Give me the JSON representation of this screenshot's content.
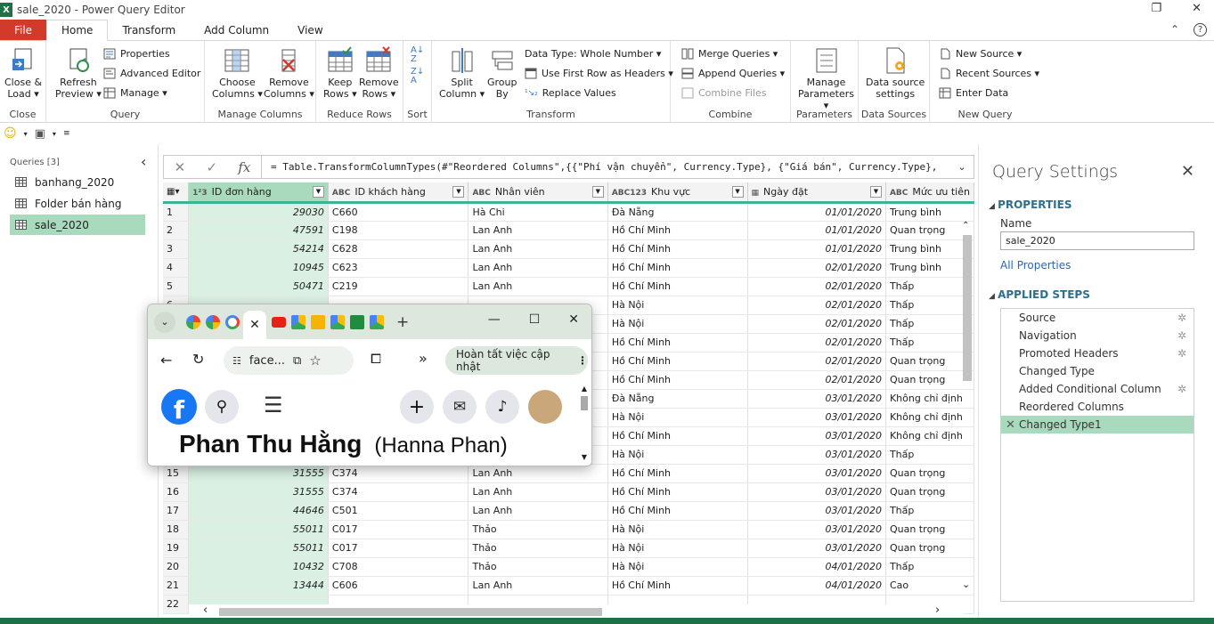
{
  "window": {
    "title": "sale_2020 - Power Query Editor",
    "app_icon": "X"
  },
  "tabs": [
    "File",
    "Home",
    "Transform",
    "Add Column",
    "View"
  ],
  "ribbon": {
    "close": {
      "close_load": "Close &",
      "close_load2": "Load",
      "label": "Close"
    },
    "query": {
      "refresh": "Refresh",
      "preview": "Preview",
      "properties": "Properties",
      "advanced_editor": "Advanced Editor",
      "manage": "Manage",
      "label": "Query"
    },
    "manage_columns": {
      "choose": "Choose",
      "choose2": "Columns",
      "remove": "Remove",
      "remove2": "Columns",
      "label": "Manage Columns"
    },
    "reduce_rows": {
      "keep": "Keep",
      "keep2": "Rows",
      "remove": "Remove",
      "remove2": "Rows",
      "label": "Reduce Rows"
    },
    "sort": {
      "label": "Sort"
    },
    "transform": {
      "split": "Split",
      "split2": "Column",
      "group": "Group",
      "group2": "By",
      "data_type": "Data Type: Whole Number",
      "first_row": "Use First Row as Headers",
      "replace": "Replace Values",
      "label": "Transform"
    },
    "combine": {
      "merge": "Merge Queries",
      "append": "Append Queries",
      "combine_files": "Combine Files",
      "label": "Combine"
    },
    "parameters": {
      "manage": "Manage",
      "manage2": "Parameters",
      "label": "Parameters"
    },
    "data_sources": {
      "settings": "Data source",
      "settings2": "settings",
      "label": "Data Sources"
    },
    "new_query": {
      "new_source": "New Source",
      "recent": "Recent Sources",
      "enter": "Enter Data",
      "label": "New Query"
    }
  },
  "queries": {
    "header": "Queries [3]",
    "items": [
      "banhang_2020",
      "Folder bán hàng",
      "sale_2020"
    ]
  },
  "formula": "= Table.TransformColumnTypes(#\"Reordered Columns\",{{\"Phí vận chuyển\", Currency.Type}, {\"Giá bán\", Currency.Type},",
  "columns": [
    {
      "type": "1²3",
      "name": "ID đơn hàng"
    },
    {
      "type": "ABC",
      "name": "ID khách hàng"
    },
    {
      "type": "ABC",
      "name": "Nhân viên"
    },
    {
      "type": "ABC123",
      "name": "Khu vực"
    },
    {
      "type": "▦",
      "name": "Ngày đặt"
    },
    {
      "type": "ABC",
      "name": "Mức ưu tiên"
    }
  ],
  "rows": [
    [
      "1",
      "29030",
      "C660",
      "Hà Chi",
      "Đà Nẵng",
      "01/01/2020",
      "Trung bình"
    ],
    [
      "2",
      "47591",
      "C198",
      "Lan Anh",
      "Hồ Chí Minh",
      "01/01/2020",
      "Quan trọng"
    ],
    [
      "3",
      "54214",
      "C628",
      "Lan Anh",
      "Hồ Chí Minh",
      "01/01/2020",
      "Trung bình"
    ],
    [
      "4",
      "10945",
      "C623",
      "Lan Anh",
      "Hồ Chí Minh",
      "02/01/2020",
      "Trung bình"
    ],
    [
      "5",
      "50471",
      "C219",
      "Lan Anh",
      "Hồ Chí Minh",
      "02/01/2020",
      "Thấp"
    ],
    [
      "6",
      "",
      "",
      "",
      "Hà Nội",
      "02/01/2020",
      "Thấp"
    ],
    [
      "7",
      "",
      "",
      "",
      "Hà Nội",
      "02/01/2020",
      "Thấp"
    ],
    [
      "8",
      "",
      "",
      "",
      "Hồ Chí Minh",
      "02/01/2020",
      "Thấp"
    ],
    [
      "9",
      "",
      "",
      "",
      "Hồ Chí Minh",
      "02/01/2020",
      "Quan trọng"
    ],
    [
      "10",
      "",
      "",
      "",
      "Hồ Chí Minh",
      "02/01/2020",
      "Quan trọng"
    ],
    [
      "11",
      "",
      "",
      "",
      "Đà Nẵng",
      "03/01/2020",
      "Không chỉ định"
    ],
    [
      "12",
      "",
      "",
      "",
      "Hà Nội",
      "03/01/2020",
      "Không chỉ định"
    ],
    [
      "13",
      "",
      "",
      "",
      "Hồ Chí Minh",
      "03/01/2020",
      "Không chỉ định"
    ],
    [
      "14",
      "",
      "",
      "",
      "Hà Nội",
      "03/01/2020",
      "Thấp"
    ],
    [
      "15",
      "31555",
      "C374",
      "Lan Anh",
      "Hồ Chí Minh",
      "03/01/2020",
      "Quan trọng"
    ],
    [
      "16",
      "31555",
      "C374",
      "Lan Anh",
      "Hồ Chí Minh",
      "03/01/2020",
      "Quan trọng"
    ],
    [
      "17",
      "44646",
      "C501",
      "Lan Anh",
      "Hồ Chí Minh",
      "03/01/2020",
      "Thấp"
    ],
    [
      "18",
      "55011",
      "C017",
      "Thảo",
      "Hà Nội",
      "03/01/2020",
      "Quan trọng"
    ],
    [
      "19",
      "55011",
      "C017",
      "Thảo",
      "Hà Nội",
      "03/01/2020",
      "Quan trọng"
    ],
    [
      "20",
      "10432",
      "C708",
      "Thảo",
      "Hà Nội",
      "04/01/2020",
      "Thấp"
    ],
    [
      "21",
      "13444",
      "C606",
      "Lan Anh",
      "Hồ Chí Minh",
      "04/01/2020",
      "Cao"
    ],
    [
      "22",
      "",
      "",
      "",
      "",
      "",
      ""
    ]
  ],
  "settings": {
    "title": "Query Settings",
    "properties": "PROPERTIES",
    "name_label": "Name",
    "name_value": "sale_2020",
    "all_properties": "All Properties",
    "applied_steps": "APPLIED STEPS",
    "steps": [
      {
        "name": "Source",
        "gear": true
      },
      {
        "name": "Navigation",
        "gear": true
      },
      {
        "name": "Promoted Headers",
        "gear": true
      },
      {
        "name": "Changed Type",
        "gear": false
      },
      {
        "name": "Added Conditional Column",
        "gear": true
      },
      {
        "name": "Reordered Columns",
        "gear": false
      },
      {
        "name": "Changed Type1",
        "gear": false
      }
    ]
  },
  "chrome": {
    "url": "face...",
    "update": "Hoàn tất việc cập nhật",
    "profile_name": "Phan Thu Hằng",
    "profile_alt": "(Hanna Phan)",
    "fb_letter": "f"
  },
  "colors": {
    "excel_green": "#1e7145",
    "file_red": "#d23a29",
    "selection": "#a8dbbd",
    "accent": "#3ab39a",
    "facebook": "#1877f2"
  }
}
